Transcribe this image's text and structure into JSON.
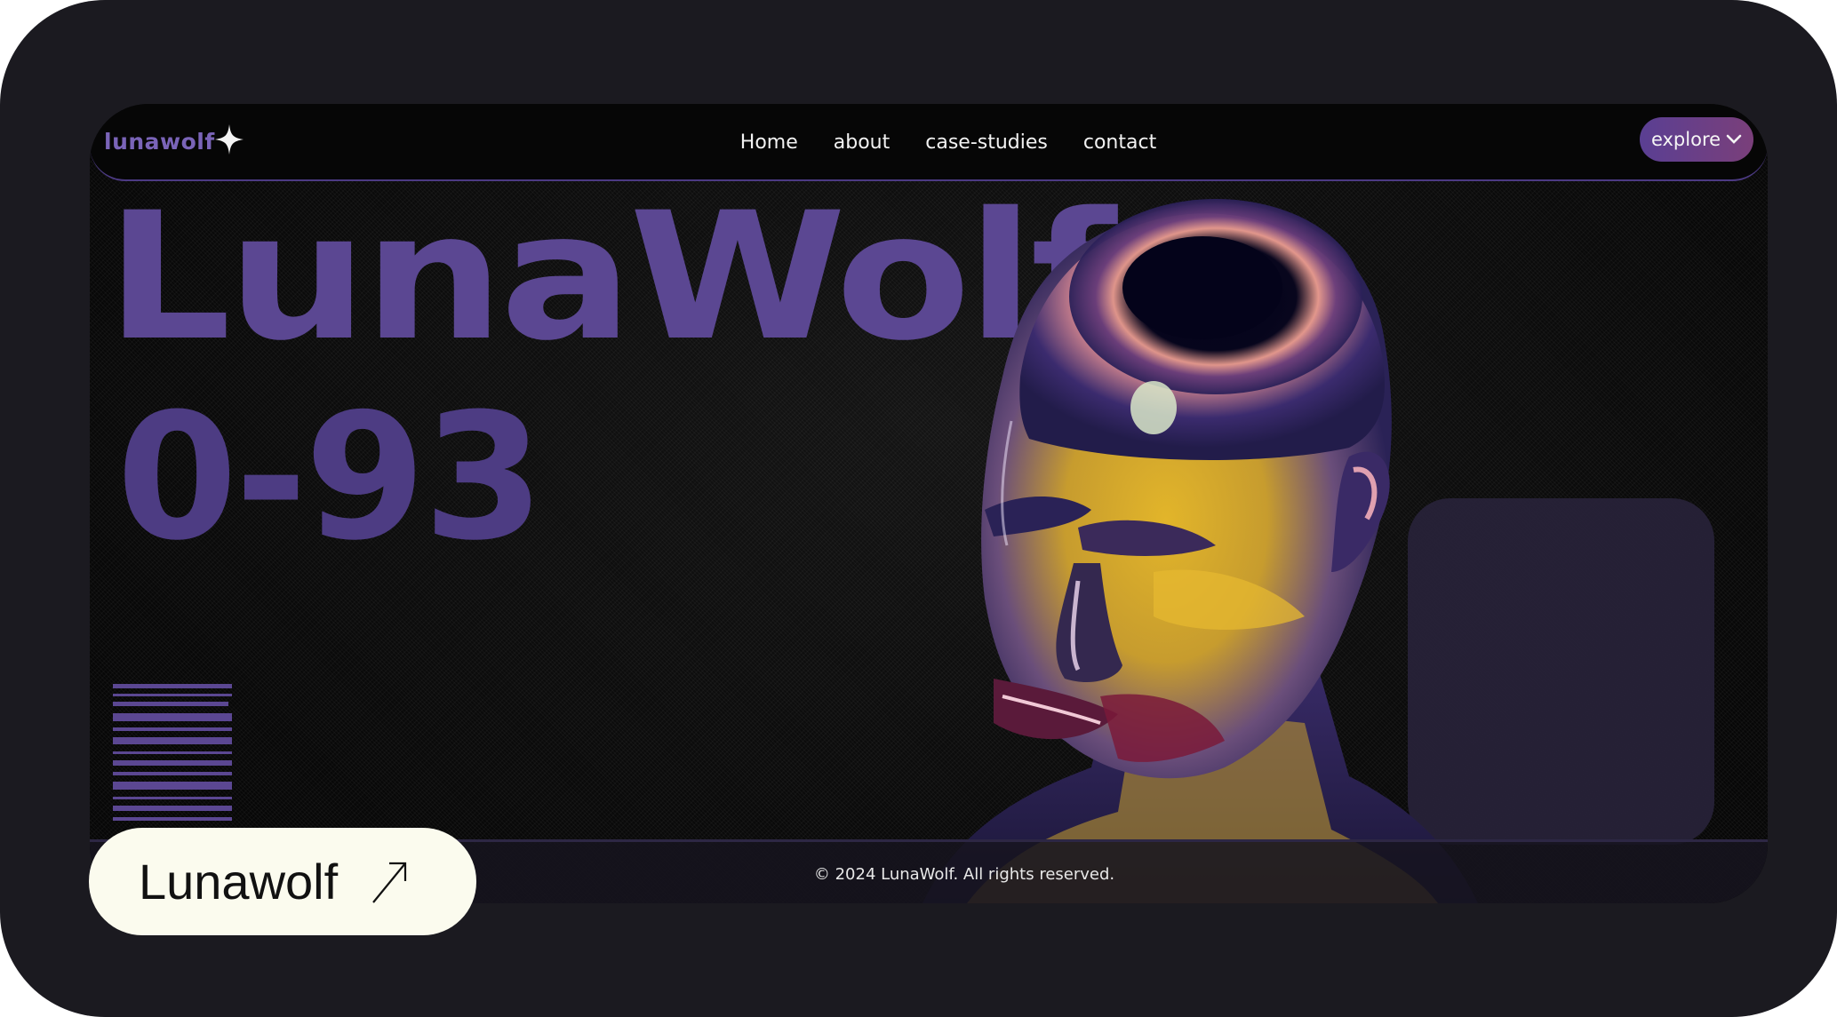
{
  "navbar": {
    "logo": "lunawolf",
    "links": [
      "Home",
      "about",
      "case-studies",
      "contact"
    ],
    "explore_label": "explore"
  },
  "hero": {
    "title": "LunaWolf",
    "number": "0-93"
  },
  "footer": {
    "copyright": "© 2024 LunaWolf. All rights reserved."
  },
  "chip": {
    "label": "Lunawolf"
  },
  "colors": {
    "frame": "#1b1a20",
    "page_bg": "#090909",
    "accent_purple": "#5b4792",
    "explore_gradient_start": "#5a3f93",
    "explore_gradient_end": "#7a3f7a",
    "chip_bg": "#fbfbee"
  },
  "icons": {
    "logo_mark": "four-point-star-icon",
    "explore_caret": "chevron-down-icon",
    "chip_arrow": "arrow-up-right-icon"
  }
}
